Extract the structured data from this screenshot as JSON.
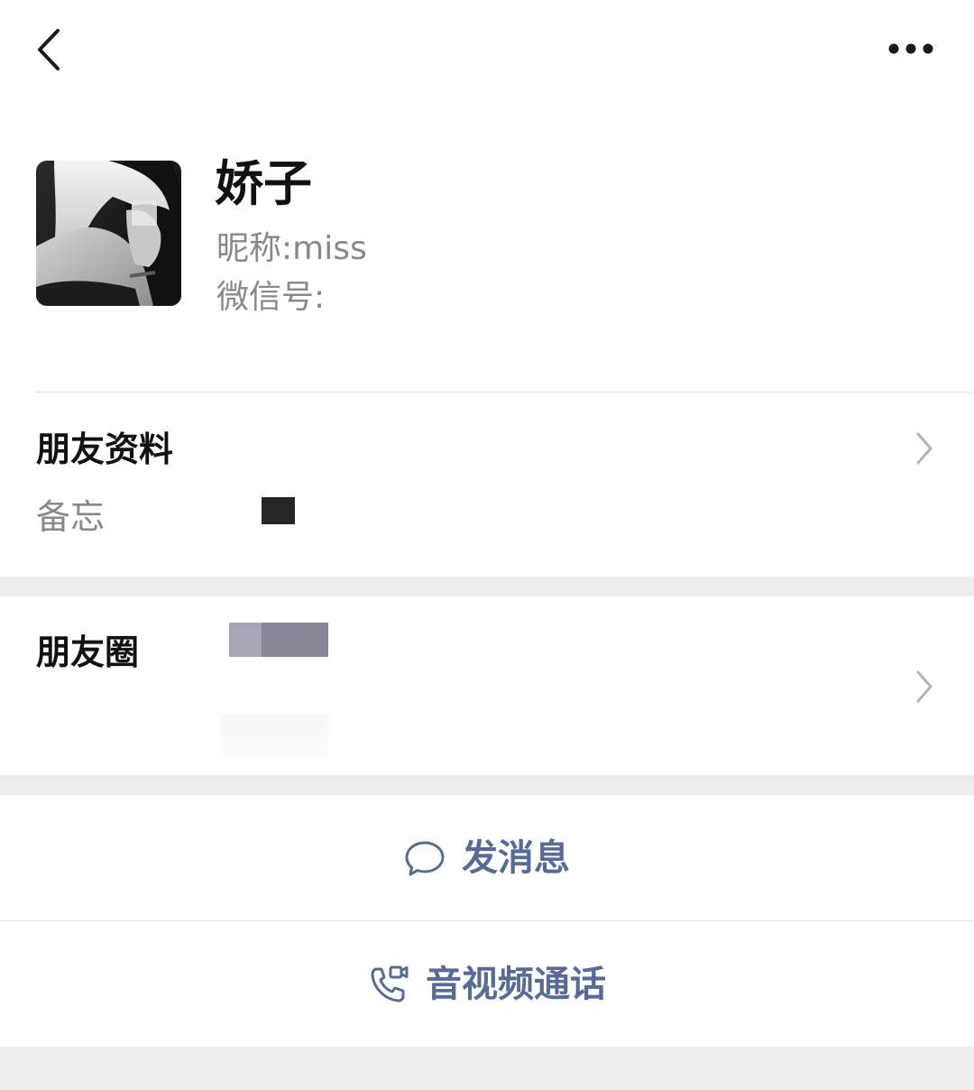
{
  "profile": {
    "display_name": "娇子",
    "nickname_label": "昵称",
    "nickname_value": "miss",
    "wechat_id_label": "微信号"
  },
  "friend_info": {
    "title": "朋友资料",
    "memo_label": "备忘"
  },
  "moments": {
    "title": "朋友圈"
  },
  "actions": {
    "send_message": "发消息",
    "video_call": "音视频通话"
  },
  "colors": {
    "page_bg": "#ededed",
    "link_blue": "#576b95",
    "secondary_text": "#888888",
    "primary_text": "#111111"
  },
  "icons": {
    "back": "chevron-left-icon",
    "more": "more-dots-icon",
    "chevron": "chevron-right-icon",
    "message": "chat-bubble-icon",
    "call": "phone-video-icon"
  }
}
